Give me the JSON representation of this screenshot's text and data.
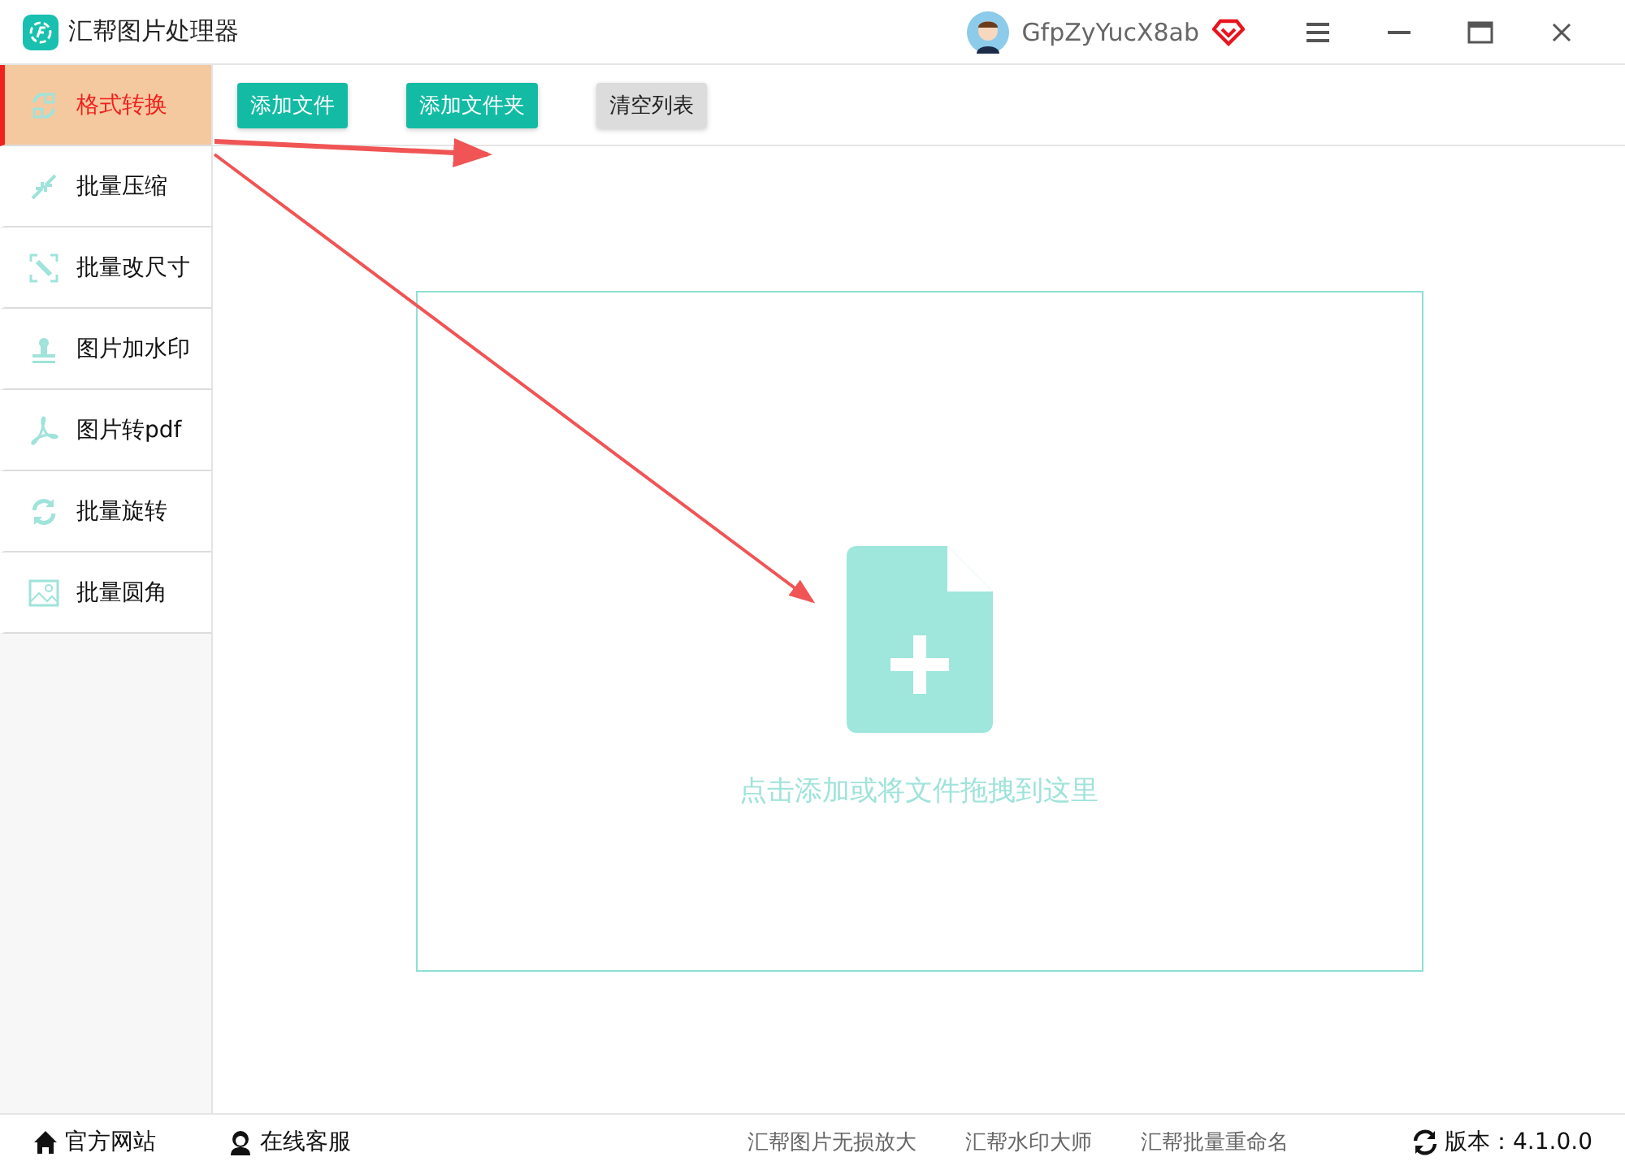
{
  "window": {
    "title": "汇帮图片处理器",
    "username": "GfpZyYucX8ab"
  },
  "sidebar": {
    "items": [
      {
        "label": "格式转换",
        "kind": "convert",
        "selected": true
      },
      {
        "label": "批量压缩",
        "kind": "compress",
        "selected": false
      },
      {
        "label": "批量改尺寸",
        "kind": "resize",
        "selected": false
      },
      {
        "label": "图片加水印",
        "kind": "stamp",
        "selected": false
      },
      {
        "label": "图片转pdf",
        "kind": "pdf",
        "selected": false
      },
      {
        "label": "批量旋转",
        "kind": "rotate",
        "selected": false
      },
      {
        "label": "批量圆角",
        "kind": "image",
        "selected": false
      }
    ]
  },
  "toolbar": {
    "buttons": [
      {
        "label": "添加文件",
        "kind": "primary"
      },
      {
        "label": "添加文件夹",
        "kind": "primary"
      },
      {
        "label": "清空列表",
        "kind": "secondary"
      }
    ]
  },
  "drop_zone": {
    "hint": "点击添加或将文件拖拽到这里"
  },
  "footer": {
    "left_links": [
      {
        "label": "官方网站",
        "kind": "home"
      },
      {
        "label": "在线客服",
        "kind": "support"
      }
    ],
    "center_links": [
      "汇帮图片无损放大",
      "汇帮水印大师",
      "汇帮批量重命名"
    ],
    "version": "版本：4.1.0.0"
  }
}
